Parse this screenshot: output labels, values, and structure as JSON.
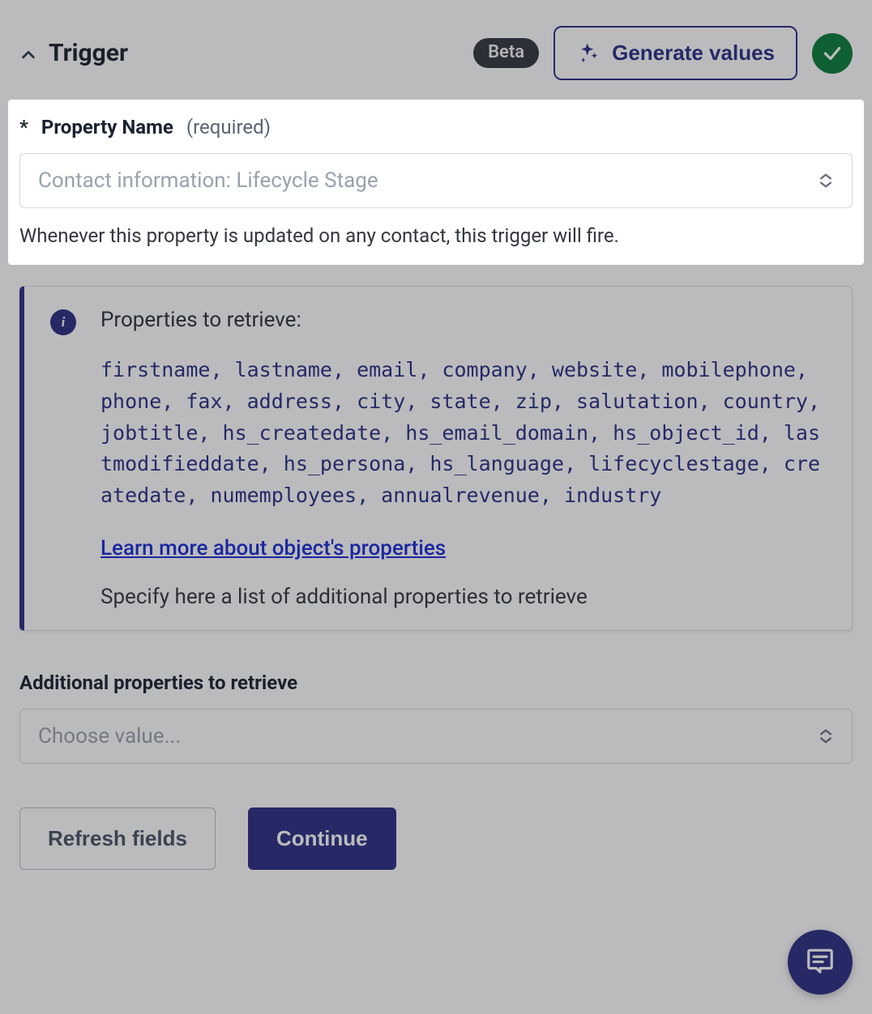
{
  "header": {
    "title": "Trigger",
    "beta_label": "Beta",
    "generate_label": "Generate values"
  },
  "property_name": {
    "asterisk": "*",
    "label": "Property Name",
    "required": "(required)",
    "selected_value": "Contact information: Lifecycle Stage",
    "help_text": "Whenever this property is updated on any contact, this trigger will fire."
  },
  "info_card": {
    "title": "Properties to retrieve:",
    "mono_properties": "firstname, lastname, email, company, website, mobilephone, phone, fax, address, city, state, zip, salutation, country, jobtitle, hs_createdate, hs_email_domain, hs_object_id, lastmodifieddate, hs_persona, hs_language, lifecyclestage, createdate, numemployees, annualrevenue, industry",
    "learn_more": "Learn more about object's properties",
    "subtitle": "Specify here a list of additional properties to retrieve"
  },
  "additional_props": {
    "label": "Additional properties to retrieve",
    "placeholder": "Choose value..."
  },
  "buttons": {
    "refresh": "Refresh fields",
    "continue": "Continue"
  }
}
